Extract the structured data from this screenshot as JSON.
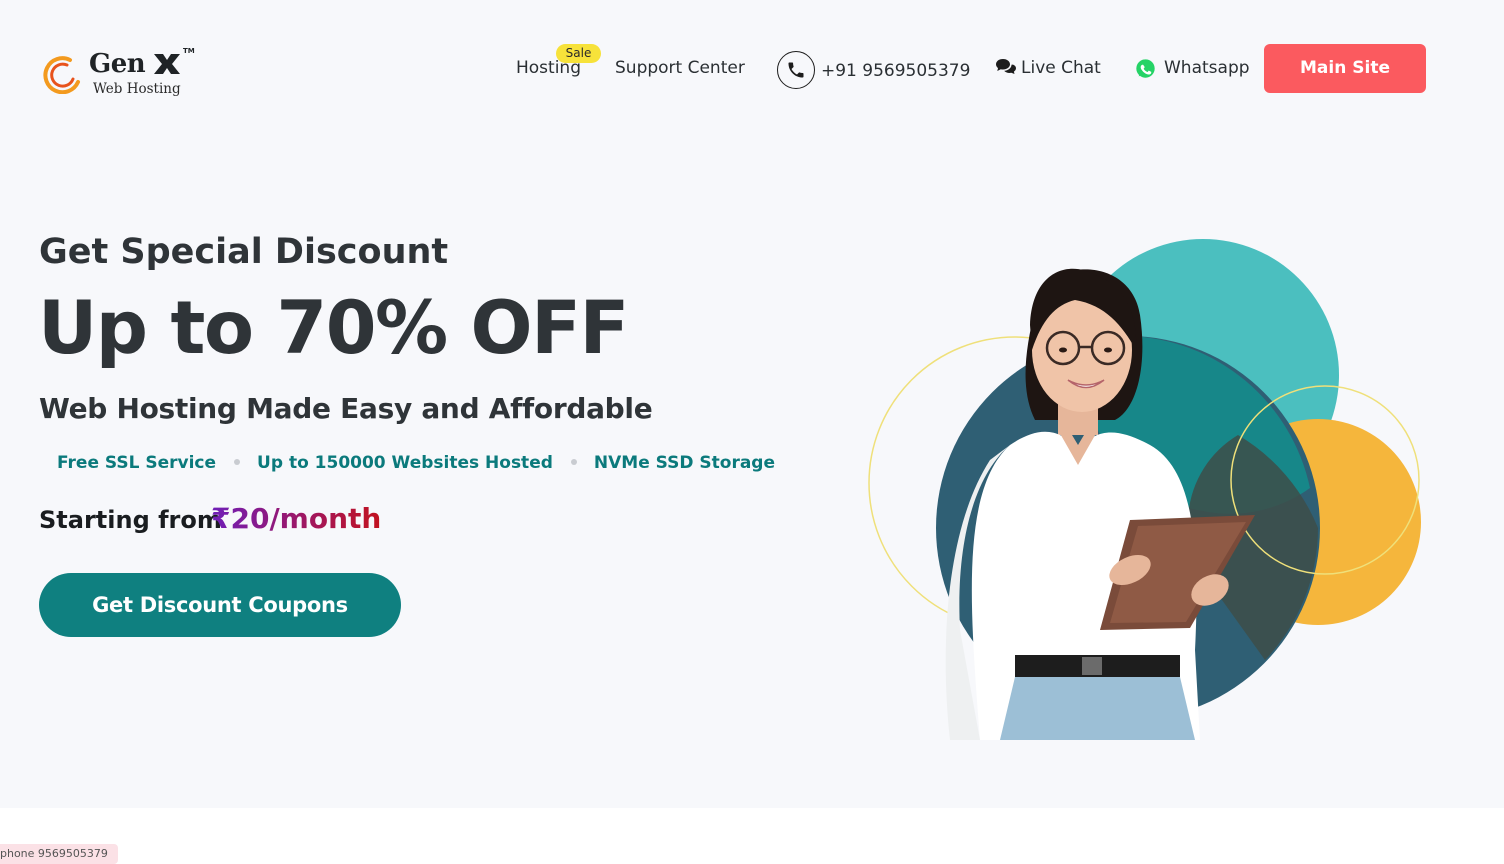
{
  "brand": {
    "name": "Gen",
    "subtitle": "Web Hosting",
    "tm": "TM"
  },
  "nav": {
    "hosting": "Hosting",
    "sale_badge": "Sale",
    "support": "Support Center",
    "phone": "+91 9569505379",
    "live_chat": "Live Chat",
    "whatsapp": "Whatsapp",
    "main_site": "Main Site"
  },
  "hero": {
    "eyebrow": "Get Special Discount",
    "headline": "Up to 70% OFF",
    "subheadline": "Web Hosting Made Easy and Affordable",
    "features": [
      "Free SSL Service",
      "Up to 150000 Websites Hosted",
      "NVMe SSD Storage"
    ],
    "starting_label": "Starting from",
    "price": "₹20/month",
    "cta": "Get Discount Coupons"
  },
  "tooltip": {
    "text": "phone 9569505379"
  },
  "colors": {
    "accent_red": "#fb5a5f",
    "teal": "#0f8080",
    "sale_yellow": "#f7e23a",
    "circle_teal": "#4bbfbf",
    "circle_dark": "#2f5f74",
    "circle_orange": "#f5b63c"
  }
}
